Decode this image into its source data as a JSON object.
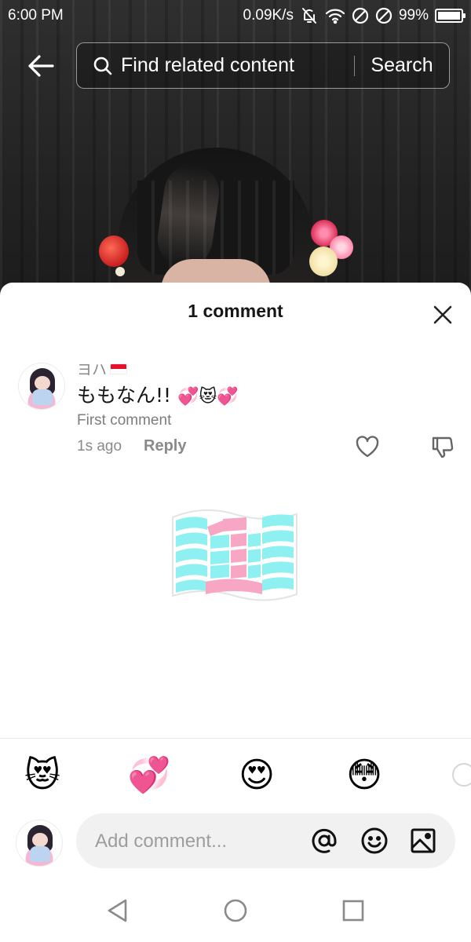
{
  "status_bar": {
    "time": "6:00 PM",
    "net_speed": "0.09K/s",
    "battery_percent": "99%",
    "battery_level": 0.99,
    "icons": [
      "bell-off-icon",
      "wifi-icon",
      "dnd-icon",
      "dnd-icon",
      "battery-icon"
    ]
  },
  "top_bar": {
    "back_icon": "arrow-left-icon",
    "search_placeholder": "Find related content",
    "search_button": "Search"
  },
  "sheet": {
    "title": "1 comment",
    "close_icon": "close-icon",
    "comment": {
      "username": "ヨハ",
      "flag": "flag-indonesia-icon",
      "text": "ももなん!!",
      "text_emojis": "💞😻💞",
      "badge": "First comment",
      "time": "1s ago",
      "reply_label": "Reply",
      "like_icon": "heart-outline-icon",
      "dislike_icon": "thumbs-down-icon"
    },
    "sticker": "number-one-flag-sticker",
    "quick_emojis": [
      "😻",
      "💞",
      "😍",
      "😳"
    ],
    "composer": {
      "placeholder": "Add comment...",
      "icons": [
        "at-icon",
        "smiley-icon",
        "image-icon"
      ]
    }
  },
  "nav_bar": {
    "icons": [
      "back-triangle-icon",
      "home-circle-icon",
      "recents-square-icon"
    ]
  },
  "colors": {
    "sticker_cyan": "#8ef0f0",
    "sticker_pink": "#f7a7c4",
    "text_primary": "#161616",
    "text_secondary": "#8a8a8a"
  }
}
